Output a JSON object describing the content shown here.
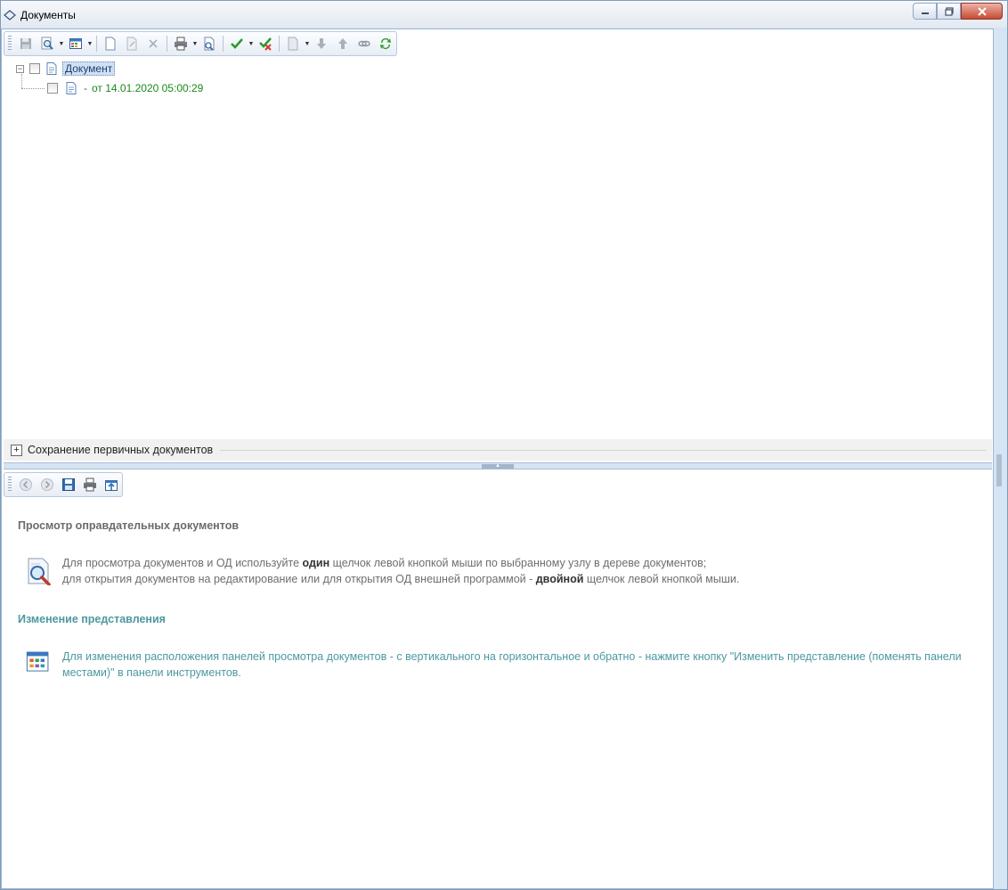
{
  "window": {
    "title": "Документы",
    "minimize_label": "Свернуть",
    "maximize_label": "Развернуть",
    "close_label": "Закрыть"
  },
  "tree": {
    "root_label": "Документ",
    "child_dash": "-",
    "child_label": "от 14.01.2020 05:00:29"
  },
  "group": {
    "label": "Сохранение первичных документов"
  },
  "help": {
    "section1_title": "Просмотр оправдательных документов",
    "section1_line1_a": "Для просмотра документов и ОД используйте ",
    "section1_line1_bold": "один",
    "section1_line1_b": " щелчок левой кнопкой мыши по выбранному узлу в дереве документов;",
    "section1_line2_a": "для открытия документов на редактирование или для открытия ОД внешней программой - ",
    "section1_line2_bold": "двойной",
    "section1_line2_b": " щелчок левой кнопкой мыши.",
    "section2_title": "Изменение представления",
    "section2_text": "Для изменения расположения панелей просмотра документов - с вертикального на горизонтальное и обратно - нажмите кнопку \"Изменить представление (поменять панели местами)\" в панели инструментов."
  },
  "colors": {
    "tree_child": "#1a8a1a",
    "help_teal": "#4d98a0",
    "help_gray": "#6b6b6b",
    "window_frame": "#d6e4f3"
  },
  "icons": {
    "toolbar": [
      "save-icon",
      "preview-icon",
      "view-layout-icon",
      "new-document-icon",
      "edit-document-icon",
      "delete-icon",
      "print-icon",
      "print-preview-icon",
      "check-icon",
      "uncheck-icon",
      "document-action-icon",
      "move-down-icon",
      "move-up-icon",
      "link-icon",
      "refresh-icon"
    ],
    "toolbar2": [
      "back-icon",
      "forward-icon",
      "save-icon",
      "print-icon",
      "export-icon"
    ]
  }
}
